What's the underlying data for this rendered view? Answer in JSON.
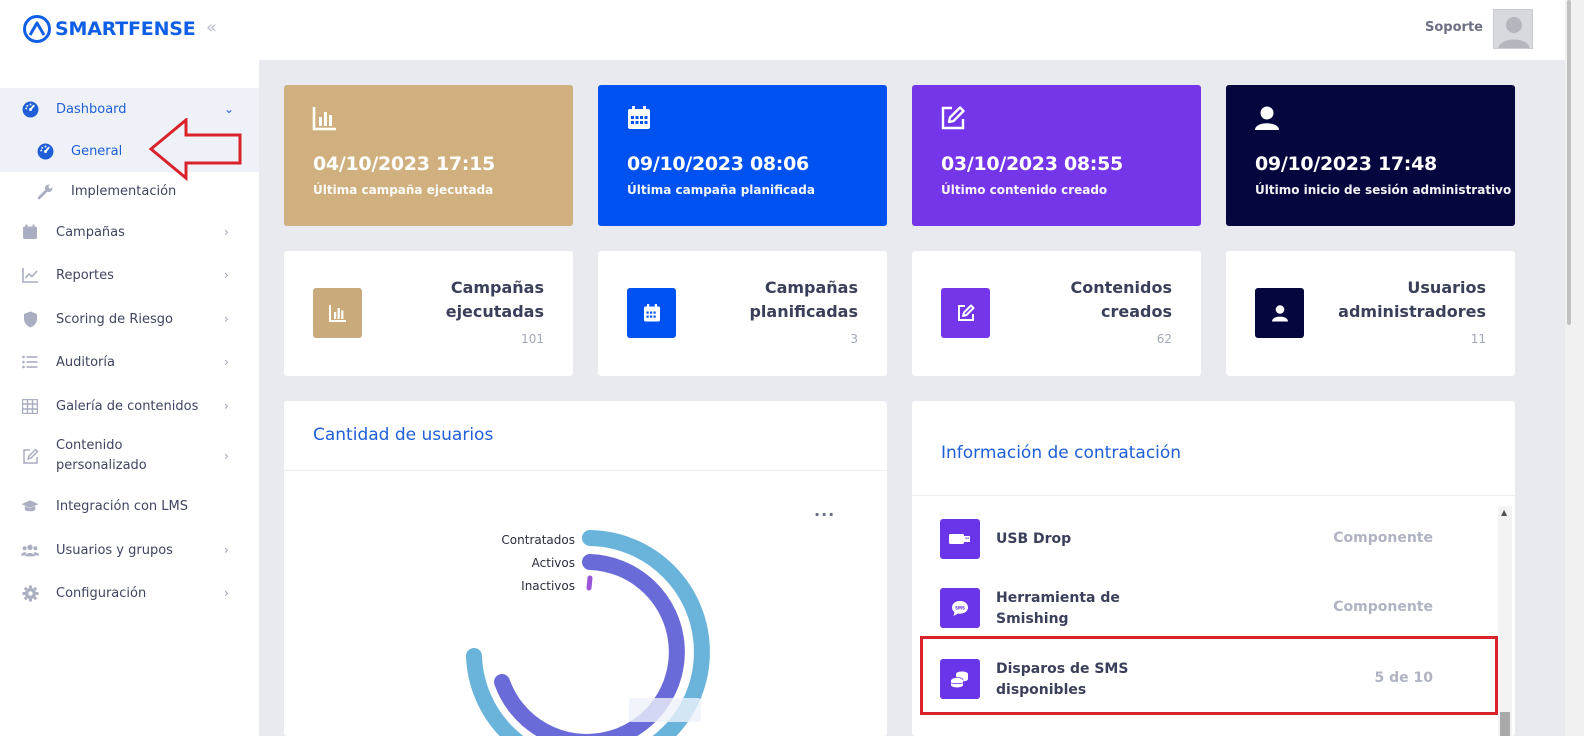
{
  "brand": {
    "name": "SMARTFENSE"
  },
  "sidebar": {
    "items": [
      {
        "label": "Dashboard",
        "icon": "dashboard-gauge-icon"
      },
      {
        "label": "General",
        "icon": "dashboard-gauge-icon"
      },
      {
        "label": "Implementación",
        "icon": "wrench-icon"
      },
      {
        "label": "Campañas",
        "icon": "calendar-icon"
      },
      {
        "label": "Reportes",
        "icon": "chart-line-icon"
      },
      {
        "label": "Scoring de Riesgo",
        "icon": "shield-icon"
      },
      {
        "label": "Auditoría",
        "icon": "list-icon"
      },
      {
        "label": "Galería de contenidos",
        "icon": "grid-icon"
      },
      {
        "label_line1": "Contenido",
        "label_line2": "personalizado",
        "icon": "edit-icon"
      },
      {
        "label": "Integración con LMS",
        "icon": "graduation-cap-icon"
      },
      {
        "label": "Usuarios y grupos",
        "icon": "users-icon"
      },
      {
        "label": "Configuración",
        "icon": "gear-icon"
      }
    ]
  },
  "topbar": {
    "user_name": "Soporte"
  },
  "stats": [
    {
      "value": "04/10/2023 17:15",
      "label": "Última campaña ejecutada",
      "color": "#cfb07e",
      "icon": "bar-chart-icon"
    },
    {
      "value": "09/10/2023 08:06",
      "label": "Última campaña planificada",
      "color": "#0052f0",
      "icon": "calendar-icon"
    },
    {
      "value": "03/10/2023 08:55",
      "label": "Último contenido creado",
      "color": "#7535e8",
      "icon": "edit-icon"
    },
    {
      "value": "09/10/2023 17:48",
      "label": "Último inicio de sesión administrativo",
      "color": "#06063f",
      "icon": "user-icon"
    }
  ],
  "metrics": [
    {
      "title_line1": "Campañas",
      "title_line2": "ejecutadas",
      "count": "101",
      "color": "#c9ab7b"
    },
    {
      "title_line1": "Campañas",
      "title_line2": "planificadas",
      "count": "3",
      "color": "#0052f0"
    },
    {
      "title_line1": "Contenidos",
      "title_line2": "creados",
      "count": "62",
      "color": "#7535e8"
    },
    {
      "title_line1": "Usuarios",
      "title_line2": "administradores",
      "count": "11",
      "color": "#06063f"
    }
  ],
  "users_panel": {
    "title": "Cantidad de usuarios",
    "menu_icon": "more-horizontal-icon",
    "chart": {
      "labels": [
        "Contratados",
        "Activos",
        "Inactivos"
      ],
      "colors": [
        "#6ab4dc",
        "#6a6ad8",
        "#9a55d8"
      ]
    }
  },
  "contract_panel": {
    "title": "Información de contratación",
    "rows": [
      {
        "name_line1": "USB Drop",
        "name_line2": "",
        "value": "Componente",
        "icon": "usb-icon"
      },
      {
        "name_line1": "Herramienta de",
        "name_line2": "Smishing",
        "value": "Componente",
        "icon": "sms-bubble-icon"
      },
      {
        "name_line1": "Disparos de SMS",
        "name_line2": "disponibles",
        "value": "5 de 10",
        "icon": "coins-icon"
      }
    ]
  },
  "annotations": {
    "arrow_color": "#d8232c",
    "box_color": "#d8232c"
  }
}
